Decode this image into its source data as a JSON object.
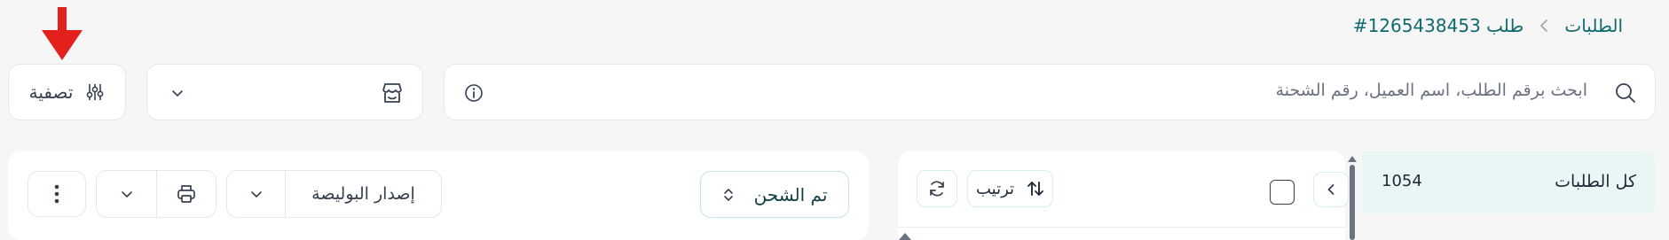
{
  "breadcrumb": {
    "root": "الطلبات",
    "current": "طلب 1265438453#"
  },
  "toolbar": {
    "search_placeholder": "ابحث برقم الطلب، اسم العميل، رقم الشحنة",
    "filter_label": "تصفية"
  },
  "orders_panel": {
    "all_orders_label": "كل الطلبات",
    "all_orders_count": "1054"
  },
  "list_controls": {
    "sort_label": "ترتيب"
  },
  "actions": {
    "status_label": "تم الشحن",
    "issue_waybill_label": "إصدار البوليصة"
  },
  "colors": {
    "accent": "#0f6a70",
    "accent_light": "#e8f7f5",
    "arrow": "#e3201b"
  }
}
